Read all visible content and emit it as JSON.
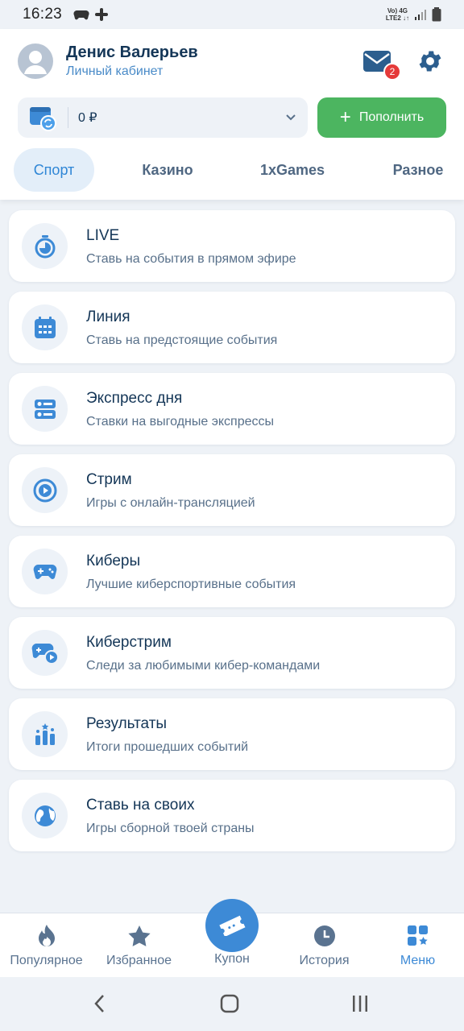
{
  "status_bar": {
    "time": "16:23",
    "network_top": "Vo) 4G",
    "network_bottom": "LTE2 ↓↑"
  },
  "user": {
    "name": "Денис Валерьев",
    "subtitle": "Личный кабинет"
  },
  "notifications": {
    "count": "2"
  },
  "balance": {
    "value": "0 ₽"
  },
  "topup": {
    "label": "Пополнить"
  },
  "tabs": [
    {
      "label": "Спорт",
      "active": true
    },
    {
      "label": "Казино",
      "active": false
    },
    {
      "label": "1xGames",
      "active": false
    },
    {
      "label": "Разное",
      "active": false
    }
  ],
  "menu": [
    {
      "title": "LIVE",
      "subtitle": "Ставь на события в прямом эфире",
      "icon": "stopwatch-icon"
    },
    {
      "title": "Линия",
      "subtitle": "Ставь на предстоящие события",
      "icon": "calendar-icon"
    },
    {
      "title": "Экспресс дня",
      "subtitle": "Ставки на выгодные экспрессы",
      "icon": "express-icon"
    },
    {
      "title": "Стрим",
      "subtitle": "Игры с онлайн-трансляцией",
      "icon": "play-circle-icon"
    },
    {
      "title": "Киберы",
      "subtitle": "Лучшие киберспортивные события",
      "icon": "gamepad-icon"
    },
    {
      "title": "Киберстрим",
      "subtitle": "Следи за любимыми кибер-командами",
      "icon": "gamepad-stream-icon"
    },
    {
      "title": "Результаты",
      "subtitle": "Итоги прошедших событий",
      "icon": "results-icon"
    },
    {
      "title": "Ставь на своих",
      "subtitle": "Игры сборной твоей страны",
      "icon": "globe-icon"
    }
  ],
  "bottom_nav": {
    "popular": "Популярное",
    "favorites": "Избранное",
    "coupon": "Купон",
    "history": "История",
    "menu": "Меню"
  },
  "colors": {
    "accent": "#3d8ad6",
    "green": "#4cb560",
    "text": "#143657",
    "badge": "#e53a3a"
  }
}
